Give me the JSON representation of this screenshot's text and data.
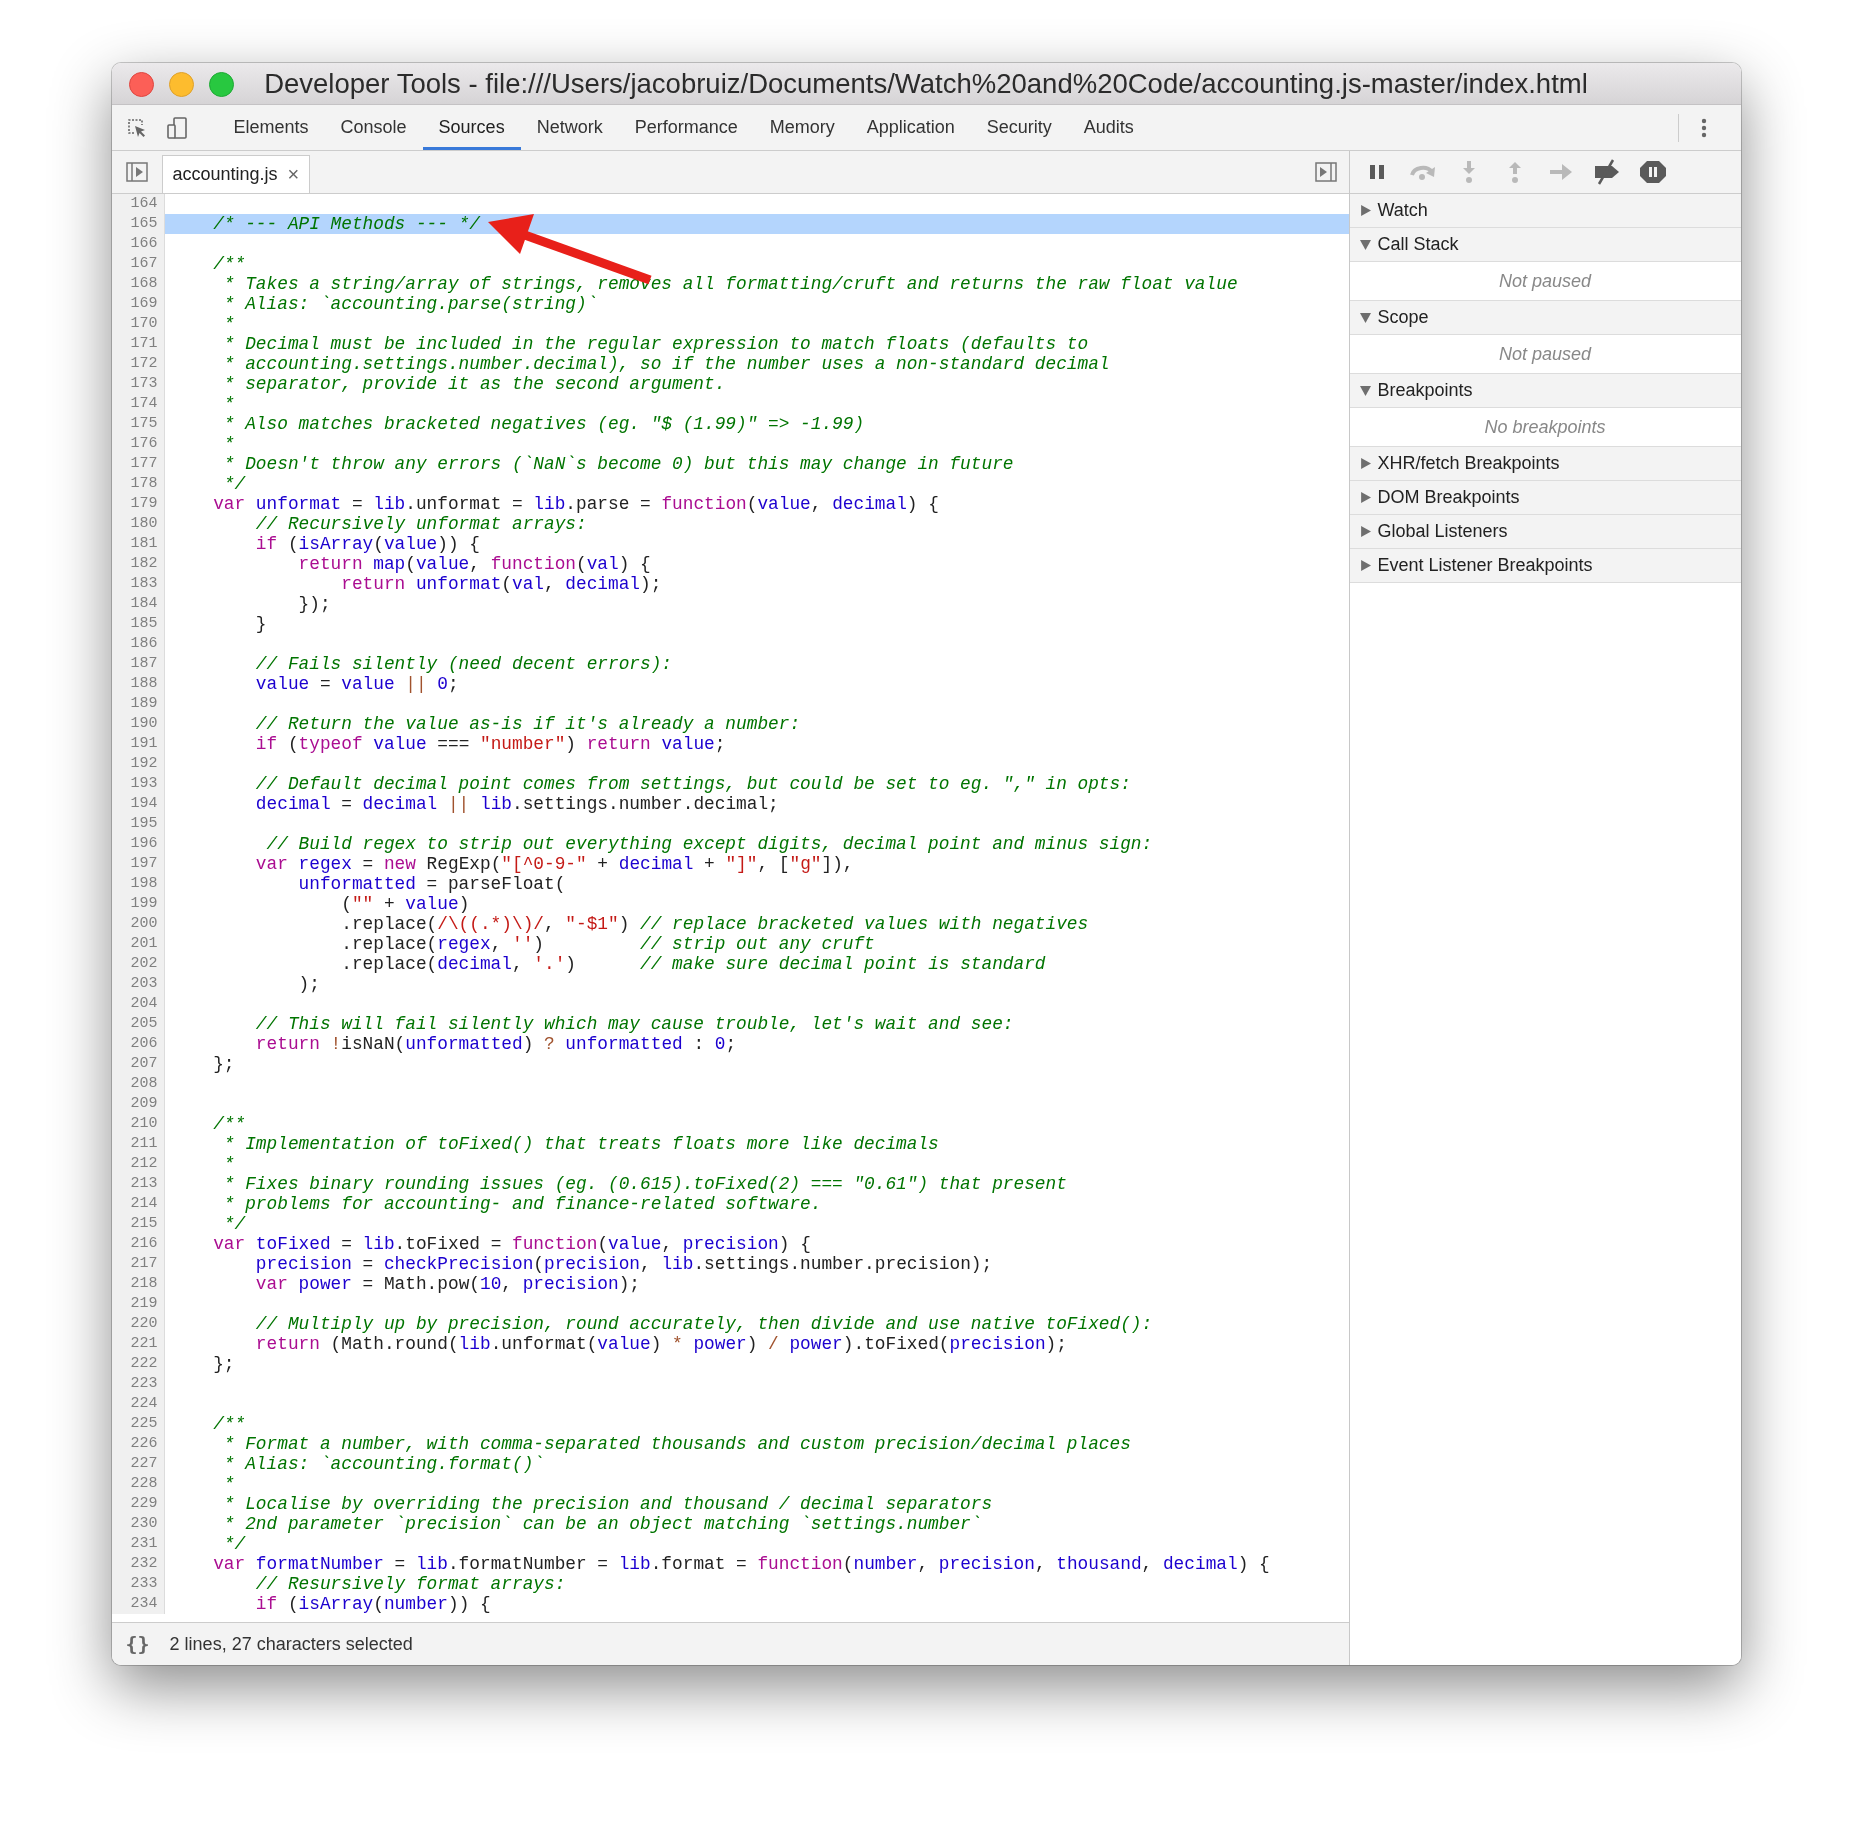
{
  "window": {
    "title": "Developer Tools - file:///Users/jacobruiz/Documents/Watch%20and%20Code/accounting.js-master/index.html"
  },
  "tabs": [
    {
      "label": "Elements",
      "selected": false
    },
    {
      "label": "Console",
      "selected": false
    },
    {
      "label": "Sources",
      "selected": true
    },
    {
      "label": "Network",
      "selected": false
    },
    {
      "label": "Performance",
      "selected": false
    },
    {
      "label": "Memory",
      "selected": false
    },
    {
      "label": "Application",
      "selected": false
    },
    {
      "label": "Security",
      "selected": false
    },
    {
      "label": "Audits",
      "selected": false
    }
  ],
  "file_tab": {
    "name": "accounting.js",
    "close": "×"
  },
  "debugger_buttons": [
    {
      "kind": "pause",
      "disabled": false
    },
    {
      "kind": "step-over",
      "disabled": true
    },
    {
      "kind": "step-into",
      "disabled": true
    },
    {
      "kind": "step-out",
      "disabled": true
    },
    {
      "kind": "step",
      "disabled": true
    },
    {
      "kind": "deactivate",
      "disabled": false
    },
    {
      "kind": "pause-exceptions",
      "disabled": false
    }
  ],
  "sections": [
    {
      "title": "Watch",
      "expanded": false
    },
    {
      "title": "Call Stack",
      "expanded": true,
      "message": "Not paused"
    },
    {
      "title": "Scope",
      "expanded": true,
      "message": "Not paused"
    },
    {
      "title": "Breakpoints",
      "expanded": true,
      "message": "No breakpoints"
    },
    {
      "title": "XHR/fetch Breakpoints",
      "expanded": false
    },
    {
      "title": "DOM Breakpoints",
      "expanded": false
    },
    {
      "title": "Global Listeners",
      "expanded": false
    },
    {
      "title": "Event Listener Breakpoints",
      "expanded": false
    }
  ],
  "code_lines": [
    {
      "number": "164",
      "highlighted": false
    },
    {
      "number": "165",
      "highlighted": true,
      "tokens": [
        {
          "kind": "comment",
          "text": "    /* --- API Methods --- */"
        }
      ]
    },
    {
      "number": "166",
      "highlighted": false
    },
    {
      "number": "167",
      "highlighted": false,
      "tokens": [
        {
          "kind": "comment",
          "text": "    /**"
        }
      ]
    },
    {
      "number": "168",
      "highlighted": false,
      "tokens": [
        {
          "kind": "comment",
          "text": "     * Takes a string/array of strings, removes all formatting/cruft and returns the raw float value"
        }
      ]
    },
    {
      "number": "169",
      "highlighted": false,
      "tokens": [
        {
          "kind": "comment",
          "text": "     * Alias: `accounting.parse(string)`"
        }
      ]
    },
    {
      "number": "170",
      "highlighted": false,
      "tokens": [
        {
          "kind": "comment",
          "text": "     *"
        }
      ]
    },
    {
      "number": "171",
      "highlighted": false,
      "tokens": [
        {
          "kind": "comment",
          "text": "     * Decimal must be included in the regular expression to match floats (defaults to"
        }
      ]
    },
    {
      "number": "172",
      "highlighted": false,
      "tokens": [
        {
          "kind": "comment",
          "text": "     * accounting.settings.number.decimal), so if the number uses a non-standard decimal"
        }
      ]
    },
    {
      "number": "173",
      "highlighted": false,
      "tokens": [
        {
          "kind": "comment",
          "text": "     * separator, provide it as the second argument."
        }
      ]
    },
    {
      "number": "174",
      "highlighted": false,
      "tokens": [
        {
          "kind": "comment",
          "text": "     *"
        }
      ]
    },
    {
      "number": "175",
      "highlighted": false,
      "tokens": [
        {
          "kind": "comment",
          "text": "     * Also matches bracketed negatives (eg. \"$ (1.99)\" => -1.99)"
        }
      ]
    },
    {
      "number": "176",
      "highlighted": false,
      "tokens": [
        {
          "kind": "comment",
          "text": "     *"
        }
      ]
    },
    {
      "number": "177",
      "highlighted": false,
      "tokens": [
        {
          "kind": "comment",
          "text": "     * Doesn't throw any errors (`NaN`s become 0) but this may change in future"
        }
      ]
    },
    {
      "number": "178",
      "highlighted": false,
      "tokens": [
        {
          "kind": "comment",
          "text": "     */"
        }
      ]
    },
    {
      "number": "179",
      "highlighted": false,
      "tokens": [
        {
          "kind": "keyword",
          "text": "    var"
        },
        {
          "kind": "name",
          "text": " unformat"
        },
        {
          "kind": "plain",
          "text": " = "
        },
        {
          "kind": "name",
          "text": "lib"
        },
        {
          "kind": "plain",
          "text": ".unformat = "
        },
        {
          "kind": "name",
          "text": "lib"
        },
        {
          "kind": "plain",
          "text": ".parse = "
        },
        {
          "kind": "keyword",
          "text": "function"
        },
        {
          "kind": "plain",
          "text": "("
        },
        {
          "kind": "name",
          "text": "value"
        },
        {
          "kind": "plain",
          "text": ", "
        },
        {
          "kind": "name",
          "text": "decimal"
        },
        {
          "kind": "plain",
          "text": ") {"
        }
      ]
    },
    {
      "number": "180",
      "highlighted": false,
      "tokens": [
        {
          "kind": "comment",
          "text": "        // Recursively unformat arrays:"
        }
      ]
    },
    {
      "number": "181",
      "highlighted": false,
      "tokens": [
        {
          "kind": "keyword",
          "text": "        if"
        },
        {
          "kind": "plain",
          "text": " ("
        },
        {
          "kind": "name",
          "text": "isArray"
        },
        {
          "kind": "plain",
          "text": "("
        },
        {
          "kind": "name",
          "text": "value"
        },
        {
          "kind": "plain",
          "text": ")) {"
        }
      ]
    },
    {
      "number": "182",
      "highlighted": false,
      "tokens": [
        {
          "kind": "keyword",
          "text": "            return"
        },
        {
          "kind": "name",
          "text": " map"
        },
        {
          "kind": "plain",
          "text": "("
        },
        {
          "kind": "name",
          "text": "value"
        },
        {
          "kind": "plain",
          "text": ", "
        },
        {
          "kind": "keyword",
          "text": "function"
        },
        {
          "kind": "plain",
          "text": "("
        },
        {
          "kind": "name",
          "text": "val"
        },
        {
          "kind": "plain",
          "text": ") {"
        }
      ]
    },
    {
      "number": "183",
      "highlighted": false,
      "tokens": [
        {
          "kind": "keyword",
          "text": "                return"
        },
        {
          "kind": "name",
          "text": " unformat"
        },
        {
          "kind": "plain",
          "text": "("
        },
        {
          "kind": "name",
          "text": "val"
        },
        {
          "kind": "plain",
          "text": ", "
        },
        {
          "kind": "name",
          "text": "decimal"
        },
        {
          "kind": "plain",
          "text": ");"
        }
      ]
    },
    {
      "number": "184",
      "highlighted": false,
      "tokens": [
        {
          "kind": "plain",
          "text": "            });"
        }
      ]
    },
    {
      "number": "185",
      "highlighted": false,
      "tokens": [
        {
          "kind": "plain",
          "text": "        }"
        }
      ]
    },
    {
      "number": "186",
      "highlighted": false
    },
    {
      "number": "187",
      "highlighted": false,
      "tokens": [
        {
          "kind": "comment",
          "text": "        // Fails silently (need decent errors):"
        }
      ]
    },
    {
      "number": "188",
      "highlighted": false,
      "tokens": [
        {
          "kind": "name",
          "text": "        value"
        },
        {
          "kind": "plain",
          "text": " = "
        },
        {
          "kind": "name",
          "text": "value"
        },
        {
          "kind": "operator",
          "text": " ||"
        },
        {
          "kind": "number",
          "text": " 0"
        },
        {
          "kind": "plain",
          "text": ";"
        }
      ]
    },
    {
      "number": "189",
      "highlighted": false
    },
    {
      "number": "190",
      "highlighted": false,
      "tokens": [
        {
          "kind": "comment",
          "text": "        // Return the value as-is if it's already a number:"
        }
      ]
    },
    {
      "number": "191",
      "highlighted": false,
      "tokens": [
        {
          "kind": "keyword",
          "text": "        if"
        },
        {
          "kind": "plain",
          "text": " ("
        },
        {
          "kind": "keyword",
          "text": "typeof"
        },
        {
          "kind": "name",
          "text": " value"
        },
        {
          "kind": "plain",
          "text": " === "
        },
        {
          "kind": "string",
          "text": "\"number\""
        },
        {
          "kind": "plain",
          "text": ") "
        },
        {
          "kind": "keyword",
          "text": "return"
        },
        {
          "kind": "name",
          "text": " value"
        },
        {
          "kind": "plain",
          "text": ";"
        }
      ]
    },
    {
      "number": "192",
      "highlighted": false
    },
    {
      "number": "193",
      "highlighted": false,
      "tokens": [
        {
          "kind": "comment",
          "text": "        // Default decimal point comes from settings, but could be set to eg. \",\" in opts:"
        }
      ]
    },
    {
      "number": "194",
      "highlighted": false,
      "tokens": [
        {
          "kind": "name",
          "text": "        decimal"
        },
        {
          "kind": "plain",
          "text": " = "
        },
        {
          "kind": "name",
          "text": "decimal"
        },
        {
          "kind": "operator",
          "text": " ||"
        },
        {
          "kind": "name",
          "text": " lib"
        },
        {
          "kind": "plain",
          "text": ".settings.number.decimal;"
        }
      ]
    },
    {
      "number": "195",
      "highlighted": false
    },
    {
      "number": "196",
      "highlighted": false,
      "tokens": [
        {
          "kind": "comment",
          "text": "         // Build regex to strip out everything except digits, decimal point and minus sign:"
        }
      ]
    },
    {
      "number": "197",
      "highlighted": false,
      "tokens": [
        {
          "kind": "keyword",
          "text": "        var"
        },
        {
          "kind": "name",
          "text": " regex"
        },
        {
          "kind": "plain",
          "text": " = "
        },
        {
          "kind": "keyword",
          "text": "new"
        },
        {
          "kind": "plain",
          "text": " RegExp("
        },
        {
          "kind": "string",
          "text": "\"[^0-9-\""
        },
        {
          "kind": "plain",
          "text": " + "
        },
        {
          "kind": "name",
          "text": "decimal"
        },
        {
          "kind": "plain",
          "text": " + "
        },
        {
          "kind": "string",
          "text": "\"]\""
        },
        {
          "kind": "plain",
          "text": ", ["
        },
        {
          "kind": "string",
          "text": "\"g\""
        },
        {
          "kind": "plain",
          "text": "]),"
        }
      ]
    },
    {
      "number": "198",
      "highlighted": false,
      "tokens": [
        {
          "kind": "name",
          "text": "            unformatted"
        },
        {
          "kind": "plain",
          "text": " = parseFloat("
        }
      ]
    },
    {
      "number": "199",
      "highlighted": false,
      "tokens": [
        {
          "kind": "plain",
          "text": "                ("
        },
        {
          "kind": "string",
          "text": "\"\""
        },
        {
          "kind": "plain",
          "text": " + "
        },
        {
          "kind": "name",
          "text": "value"
        },
        {
          "kind": "plain",
          "text": ")"
        }
      ]
    },
    {
      "number": "200",
      "highlighted": false,
      "tokens": [
        {
          "kind": "plain",
          "text": "                .replace("
        },
        {
          "kind": "string",
          "text": "/\\((.*)\\)/"
        },
        {
          "kind": "plain",
          "text": ", "
        },
        {
          "kind": "string",
          "text": "\"-$1\""
        },
        {
          "kind": "plain",
          "text": ") "
        },
        {
          "kind": "comment",
          "text": "// replace bracketed values with negatives"
        }
      ]
    },
    {
      "number": "201",
      "highlighted": false,
      "tokens": [
        {
          "kind": "plain",
          "text": "                .replace("
        },
        {
          "kind": "name",
          "text": "regex"
        },
        {
          "kind": "plain",
          "text": ", "
        },
        {
          "kind": "string",
          "text": "''"
        },
        {
          "kind": "plain",
          "text": ")         "
        },
        {
          "kind": "comment",
          "text": "// strip out any cruft"
        }
      ]
    },
    {
      "number": "202",
      "highlighted": false,
      "tokens": [
        {
          "kind": "plain",
          "text": "                .replace("
        },
        {
          "kind": "name",
          "text": "decimal"
        },
        {
          "kind": "plain",
          "text": ", "
        },
        {
          "kind": "string",
          "text": "'.'"
        },
        {
          "kind": "plain",
          "text": ")      "
        },
        {
          "kind": "comment",
          "text": "// make sure decimal point is standard"
        }
      ]
    },
    {
      "number": "203",
      "highlighted": false,
      "tokens": [
        {
          "kind": "plain",
          "text": "            );"
        }
      ]
    },
    {
      "number": "204",
      "highlighted": false
    },
    {
      "number": "205",
      "highlighted": false,
      "tokens": [
        {
          "kind": "comment",
          "text": "        // This will fail silently which may cause trouble, let's wait and see:"
        }
      ]
    },
    {
      "number": "206",
      "highlighted": false,
      "tokens": [
        {
          "kind": "keyword",
          "text": "        return"
        },
        {
          "kind": "operator",
          "text": " !"
        },
        {
          "kind": "plain",
          "text": "isNaN("
        },
        {
          "kind": "name",
          "text": "unformatted"
        },
        {
          "kind": "plain",
          "text": ") "
        },
        {
          "kind": "operator",
          "text": "?"
        },
        {
          "kind": "name",
          "text": " unformatted"
        },
        {
          "kind": "plain",
          "text": " : "
        },
        {
          "kind": "number",
          "text": "0"
        },
        {
          "kind": "plain",
          "text": ";"
        }
      ]
    },
    {
      "number": "207",
      "highlighted": false,
      "tokens": [
        {
          "kind": "plain",
          "text": "    };"
        }
      ]
    },
    {
      "number": "208",
      "highlighted": false
    },
    {
      "number": "209",
      "highlighted": false
    },
    {
      "number": "210",
      "highlighted": false,
      "tokens": [
        {
          "kind": "comment",
          "text": "    /**"
        }
      ]
    },
    {
      "number": "211",
      "highlighted": false,
      "tokens": [
        {
          "kind": "comment",
          "text": "     * Implementation of toFixed() that treats floats more like decimals"
        }
      ]
    },
    {
      "number": "212",
      "highlighted": false,
      "tokens": [
        {
          "kind": "comment",
          "text": "     *"
        }
      ]
    },
    {
      "number": "213",
      "highlighted": false,
      "tokens": [
        {
          "kind": "comment",
          "text": "     * Fixes binary rounding issues (eg. (0.615).toFixed(2) === \"0.61\") that present"
        }
      ]
    },
    {
      "number": "214",
      "highlighted": false,
      "tokens": [
        {
          "kind": "comment",
          "text": "     * problems for accounting- and finance-related software."
        }
      ]
    },
    {
      "number": "215",
      "highlighted": false,
      "tokens": [
        {
          "kind": "comment",
          "text": "     */"
        }
      ]
    },
    {
      "number": "216",
      "highlighted": false,
      "tokens": [
        {
          "kind": "keyword",
          "text": "    var"
        },
        {
          "kind": "name",
          "text": " toFixed"
        },
        {
          "kind": "plain",
          "text": " = "
        },
        {
          "kind": "name",
          "text": "lib"
        },
        {
          "kind": "plain",
          "text": ".toFixed = "
        },
        {
          "kind": "keyword",
          "text": "function"
        },
        {
          "kind": "plain",
          "text": "("
        },
        {
          "kind": "name",
          "text": "value"
        },
        {
          "kind": "plain",
          "text": ", "
        },
        {
          "kind": "name",
          "text": "precision"
        },
        {
          "kind": "plain",
          "text": ") {"
        }
      ]
    },
    {
      "number": "217",
      "highlighted": false,
      "tokens": [
        {
          "kind": "name",
          "text": "        precision"
        },
        {
          "kind": "plain",
          "text": " = "
        },
        {
          "kind": "name",
          "text": "checkPrecision"
        },
        {
          "kind": "plain",
          "text": "("
        },
        {
          "kind": "name",
          "text": "precision"
        },
        {
          "kind": "plain",
          "text": ", "
        },
        {
          "kind": "name",
          "text": "lib"
        },
        {
          "kind": "plain",
          "text": ".settings.number.precision);"
        }
      ]
    },
    {
      "number": "218",
      "highlighted": false,
      "tokens": [
        {
          "kind": "keyword",
          "text": "        var"
        },
        {
          "kind": "name",
          "text": " power"
        },
        {
          "kind": "plain",
          "text": " = Math.pow("
        },
        {
          "kind": "number",
          "text": "10"
        },
        {
          "kind": "plain",
          "text": ", "
        },
        {
          "kind": "name",
          "text": "precision"
        },
        {
          "kind": "plain",
          "text": ");"
        }
      ]
    },
    {
      "number": "219",
      "highlighted": false
    },
    {
      "number": "220",
      "highlighted": false,
      "tokens": [
        {
          "kind": "comment",
          "text": "        // Multiply up by precision, round accurately, then divide and use native toFixed():"
        }
      ]
    },
    {
      "number": "221",
      "highlighted": false,
      "tokens": [
        {
          "kind": "keyword",
          "text": "        return"
        },
        {
          "kind": "plain",
          "text": " (Math.round("
        },
        {
          "kind": "name",
          "text": "lib"
        },
        {
          "kind": "plain",
          "text": ".unformat("
        },
        {
          "kind": "name",
          "text": "value"
        },
        {
          "kind": "plain",
          "text": ") "
        },
        {
          "kind": "operator",
          "text": "*"
        },
        {
          "kind": "name",
          "text": " power"
        },
        {
          "kind": "plain",
          "text": ") "
        },
        {
          "kind": "operator",
          "text": "/"
        },
        {
          "kind": "name",
          "text": " power"
        },
        {
          "kind": "plain",
          "text": ").toFixed("
        },
        {
          "kind": "name",
          "text": "precision"
        },
        {
          "kind": "plain",
          "text": ");"
        }
      ]
    },
    {
      "number": "222",
      "highlighted": false,
      "tokens": [
        {
          "kind": "plain",
          "text": "    };"
        }
      ]
    },
    {
      "number": "223",
      "highlighted": false
    },
    {
      "number": "224",
      "highlighted": false
    },
    {
      "number": "225",
      "highlighted": false,
      "tokens": [
        {
          "kind": "comment",
          "text": "    /**"
        }
      ]
    },
    {
      "number": "226",
      "highlighted": false,
      "tokens": [
        {
          "kind": "comment",
          "text": "     * Format a number, with comma-separated thousands and custom precision/decimal places"
        }
      ]
    },
    {
      "number": "227",
      "highlighted": false,
      "tokens": [
        {
          "kind": "comment",
          "text": "     * Alias: `accounting.format()`"
        }
      ]
    },
    {
      "number": "228",
      "highlighted": false,
      "tokens": [
        {
          "kind": "comment",
          "text": "     *"
        }
      ]
    },
    {
      "number": "229",
      "highlighted": false,
      "tokens": [
        {
          "kind": "comment",
          "text": "     * Localise by overriding the precision and thousand / decimal separators"
        }
      ]
    },
    {
      "number": "230",
      "highlighted": false,
      "tokens": [
        {
          "kind": "comment",
          "text": "     * 2nd parameter `precision` can be an object matching `settings.number`"
        }
      ]
    },
    {
      "number": "231",
      "highlighted": false,
      "tokens": [
        {
          "kind": "comment",
          "text": "     */"
        }
      ]
    },
    {
      "number": "232",
      "highlighted": false,
      "tokens": [
        {
          "kind": "keyword",
          "text": "    var"
        },
        {
          "kind": "name",
          "text": " formatNumber"
        },
        {
          "kind": "plain",
          "text": " = "
        },
        {
          "kind": "name",
          "text": "lib"
        },
        {
          "kind": "plain",
          "text": ".formatNumber = "
        },
        {
          "kind": "name",
          "text": "lib"
        },
        {
          "kind": "plain",
          "text": ".format = "
        },
        {
          "kind": "keyword",
          "text": "function"
        },
        {
          "kind": "plain",
          "text": "("
        },
        {
          "kind": "name",
          "text": "number"
        },
        {
          "kind": "plain",
          "text": ", "
        },
        {
          "kind": "name",
          "text": "precision"
        },
        {
          "kind": "plain",
          "text": ", "
        },
        {
          "kind": "name",
          "text": "thousand"
        },
        {
          "kind": "plain",
          "text": ", "
        },
        {
          "kind": "name",
          "text": "decimal"
        },
        {
          "kind": "plain",
          "text": ") {"
        }
      ]
    },
    {
      "number": "233",
      "highlighted": false,
      "tokens": [
        {
          "kind": "comment",
          "text": "        // Resursively format arrays:"
        }
      ]
    },
    {
      "number": "234",
      "highlighted": false,
      "tokens": [
        {
          "kind": "keyword",
          "text": "        if"
        },
        {
          "kind": "plain",
          "text": " ("
        },
        {
          "kind": "name",
          "text": "isArray"
        },
        {
          "kind": "plain",
          "text": "("
        },
        {
          "kind": "name",
          "text": "number"
        },
        {
          "kind": "plain",
          "text": ")) {"
        }
      ]
    }
  ],
  "status_bar": {
    "format_button": "{}",
    "text": "2 lines, 27 characters selected"
  }
}
